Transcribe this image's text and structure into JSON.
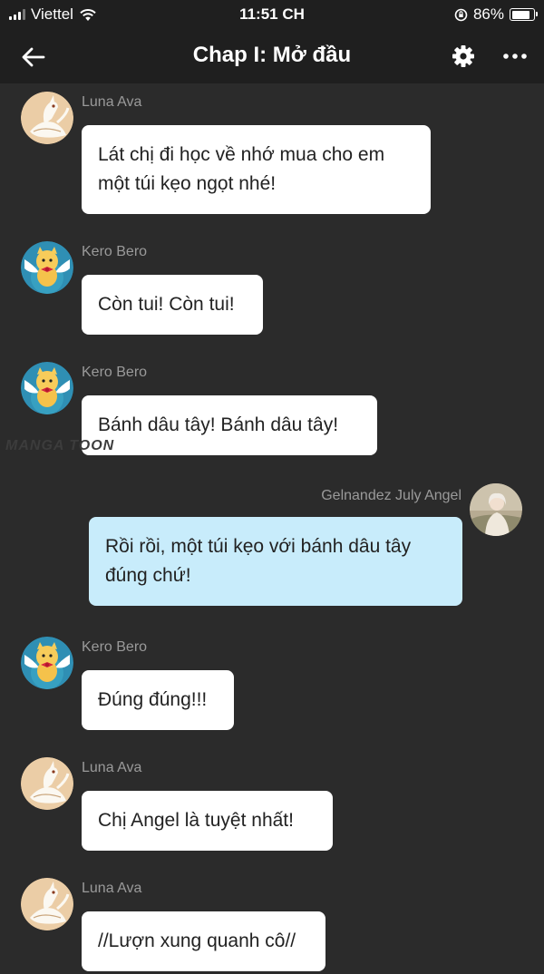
{
  "status_bar": {
    "carrier": "Viettel",
    "time": "11:51 CH",
    "battery_percent": "86%",
    "battery_level": 0.86
  },
  "nav": {
    "title": "Chap I: Mở đầu",
    "icons": [
      "back-arrow-icon",
      "gear-icon",
      "more-icon"
    ]
  },
  "watermark": "MANGA TOON",
  "messages": [
    {
      "sender": "Luna Ava",
      "avatar": "white-dragon-avatar",
      "side": "left",
      "lines": [
        "Lát chị đi học về nhớ mua cho em",
        "một túi kẹo ngọt nhé!"
      ]
    },
    {
      "sender": "Kero Bero",
      "avatar": "kero-avatar",
      "side": "left",
      "lines": [
        "Còn tui! Còn tui!"
      ]
    },
    {
      "sender": "Kero Bero",
      "avatar": "kero-avatar",
      "side": "left",
      "lines": [
        "Bánh dâu tây! Bánh dâu tây!"
      ]
    },
    {
      "sender": "Gelnandez July Angel",
      "avatar": "girl-photo-avatar",
      "side": "right",
      "lines": [
        "Rồi rồi, một túi kẹo với bánh dâu tây",
        "đúng chứ!"
      ]
    },
    {
      "sender": "Kero Bero",
      "avatar": "kero-avatar",
      "side": "left",
      "lines": [
        "Đúng đúng!!!"
      ]
    },
    {
      "sender": "Luna Ava",
      "avatar": "white-dragon-avatar",
      "side": "left",
      "lines": [
        "Chị Angel là tuyệt nhất!"
      ]
    },
    {
      "sender": "Luna Ava",
      "avatar": "white-dragon-avatar",
      "side": "left",
      "lines": [
        "//Lượn xung quanh cô//"
      ]
    }
  ],
  "colors": {
    "background": "#2b2b2b",
    "header": "#1f1f1f",
    "bubble_other": "#ffffff",
    "bubble_me": "#c8ecfb",
    "name_text": "#9a9a9a"
  }
}
